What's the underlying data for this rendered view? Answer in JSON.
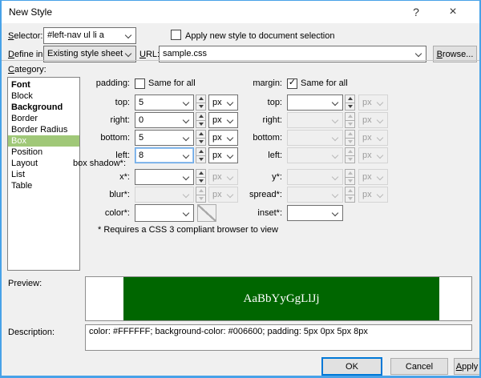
{
  "window": {
    "title": "New Style",
    "help_glyph": "?",
    "close_glyph": "×"
  },
  "colors": {
    "dialog_border": "#48A2E8",
    "accent": "#0078D7",
    "category_selected_bg": "#A0C878",
    "preview_bg": "#006600",
    "preview_fg": "#FFFFFF"
  },
  "header": {
    "selector_label": "Selector:",
    "selector_value": "#left-nav ul li a",
    "apply_checkbox_label": "Apply new style to document selection",
    "apply_check_glyph": "",
    "define_in_label": "Define in:",
    "define_in_value": "Existing style sheet",
    "url_label": "URL:",
    "url_value": "sample.css",
    "browse_button": "Browse..."
  },
  "category": {
    "label": "Category:",
    "selected": "Box",
    "items": [
      {
        "label": "Font",
        "bold": true
      },
      {
        "label": "Block",
        "bold": false
      },
      {
        "label": "Background",
        "bold": true
      },
      {
        "label": "Border",
        "bold": false
      },
      {
        "label": "Border Radius",
        "bold": false
      },
      {
        "label": "Box",
        "bold": false
      },
      {
        "label": "Position",
        "bold": false
      },
      {
        "label": "Layout",
        "bold": false
      },
      {
        "label": "List",
        "bold": false
      },
      {
        "label": "Table",
        "bold": false
      }
    ]
  },
  "box_panel": {
    "padding_label": "padding:",
    "padding_same_label": "Same for all",
    "padding_check_glyph": "",
    "margin_label": "margin:",
    "margin_same_label": "Same for all",
    "margin_check_glyph": "✓",
    "padding_rows": [
      {
        "label": "top:",
        "value": "5",
        "unit": "px",
        "enabled": true
      },
      {
        "label": "right:",
        "value": "0",
        "unit": "px",
        "enabled": true
      },
      {
        "label": "bottom:",
        "value": "5",
        "unit": "px",
        "enabled": true
      },
      {
        "label": "left:",
        "value": "8",
        "unit": "px",
        "enabled": true,
        "focused": true
      }
    ],
    "margin_rows": [
      {
        "label": "top:",
        "value": "",
        "unit": "px",
        "enabled": true
      },
      {
        "label": "right:",
        "value": "",
        "unit": "px",
        "enabled": false
      },
      {
        "label": "bottom:",
        "value": "",
        "unit": "px",
        "enabled": false
      },
      {
        "label": "left:",
        "value": "",
        "unit": "px",
        "enabled": false
      }
    ],
    "box_shadow_label": "box shadow*:",
    "shadow_left_rows": [
      {
        "label": "x*:",
        "value": "",
        "unit": "px",
        "enabled": true
      },
      {
        "label": "blur*:",
        "value": "",
        "unit": "px",
        "enabled": false
      }
    ],
    "shadow_right_rows": [
      {
        "label": "y*:",
        "value": "",
        "unit": "px",
        "enabled": false
      },
      {
        "label": "spread*:",
        "value": "",
        "unit": "px",
        "enabled": false
      }
    ],
    "color_row": {
      "label": "color*:",
      "value": ""
    },
    "inset_row": {
      "label": "inset*:",
      "value": ""
    },
    "footnote": "* Requires a CSS 3 compliant browser to view"
  },
  "preview": {
    "label": "Preview:",
    "sample_text": "AaBbYyGgLlJj"
  },
  "description": {
    "label": "Description:",
    "text": "color: #FFFFFF; background-color: #006600; padding: 5px 0px 5px 8px"
  },
  "footer": {
    "ok": "OK",
    "cancel": "Cancel",
    "apply": "Apply"
  }
}
